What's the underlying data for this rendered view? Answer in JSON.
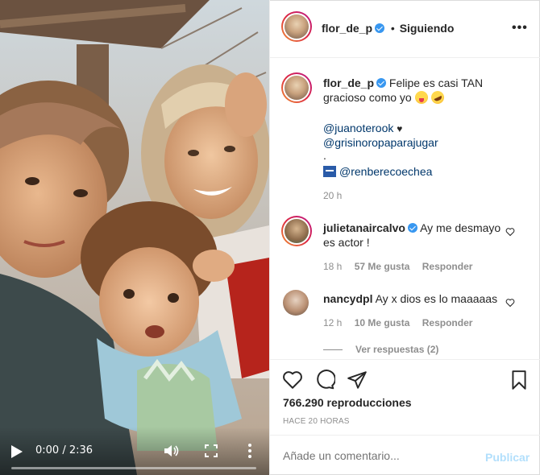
{
  "colors": {
    "accent": "#3897f0",
    "link": "#00376b",
    "muted": "#8e8e8e",
    "publish_disabled": "#b2dffc"
  },
  "video": {
    "time": "0:00 / 2:36",
    "progress": 0
  },
  "header": {
    "username": "flor_de_p",
    "separator": "•",
    "follow_label": "Siguiendo",
    "more_icon": "more-horizontal-icon"
  },
  "caption": {
    "username": "flor_de_p",
    "text": "Felipe es casi TAN gracioso como yo",
    "mention1": "@juanoterook",
    "heart": "♥",
    "mention2": "@grisinoropaparajugar",
    "dot": ".",
    "mention3": "@renberecoechea",
    "time": "20 h"
  },
  "comments": [
    {
      "username": "julietanaircalvo",
      "text": "Ay me desmayo es actor !",
      "time": "18 h",
      "likes": "57 Me gusta",
      "reply": "Responder"
    },
    {
      "username": "nancydpl",
      "text": "Ay x dios es lo maaaaas",
      "time": "12 h",
      "likes": "10 Me gusta",
      "reply": "Responder"
    }
  ],
  "view_replies": "Ver respuestas (2)",
  "stats": {
    "views": "766.290 reproducciones",
    "ago": "HACE 20 HORAS"
  },
  "add_comment": {
    "placeholder": "Añade un comentario...",
    "publish_label": "Publicar"
  }
}
